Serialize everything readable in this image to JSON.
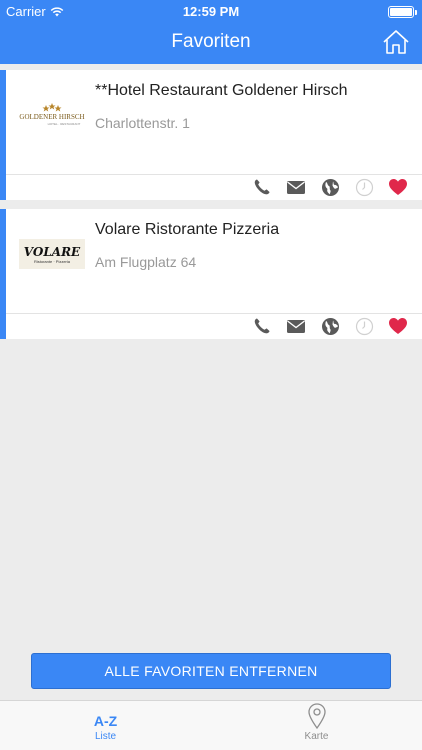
{
  "status": {
    "carrier": "Carrier",
    "time": "12:59 PM"
  },
  "nav": {
    "title": "Favoriten",
    "home_icon": "home-icon"
  },
  "favorites": [
    {
      "name": "**Hotel Restaurant Goldener Hirsch",
      "address": "Charlottenstr. 1",
      "logo_text": "GOLDENER HIRSCH",
      "logo_subtext": "HOTEL · RESTAURANT",
      "actions": [
        "phone-icon",
        "mail-icon",
        "globe-icon",
        "clock-icon",
        "heart-icon"
      ]
    },
    {
      "name": "Volare Ristorante Pizzeria",
      "address": "Am Flugplatz 64",
      "logo_text": "VOLARE",
      "logo_subtext": "Ristorante · Pizzeria",
      "actions": [
        "phone-icon",
        "mail-icon",
        "globe-icon",
        "clock-icon",
        "heart-icon"
      ]
    }
  ],
  "remove_all_label": "ALLE FAVORITEN ENTFERNEN",
  "tabs": [
    {
      "label": "Liste",
      "icon_text": "A-Z",
      "active": true
    },
    {
      "label": "Karte",
      "icon": "map-pin-icon",
      "active": false
    }
  ],
  "colors": {
    "accent": "#3a87f5",
    "heart": "#e0284b",
    "icon_gray": "#5a5a5a",
    "clock_gray": "#d0d0d0"
  }
}
